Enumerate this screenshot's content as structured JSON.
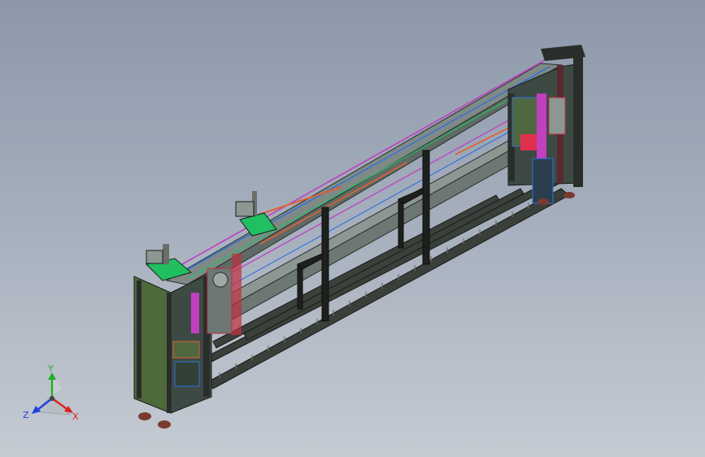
{
  "viewport": {
    "background_top": "#8c98aa",
    "background_bottom": "#c5cbd3"
  },
  "model": {
    "frame_color": "#2a2e2b",
    "rail_color": "#7f8a86",
    "accent_colors": [
      "#c040c0",
      "#3070e0",
      "#20c060",
      "#e06030",
      "#c03040",
      "#506840"
    ]
  },
  "triad": {
    "x_label": "X",
    "y_label": "Y",
    "z_label": "Z",
    "x_color": "#e02020",
    "y_color": "#20b020",
    "z_color": "#2040e0"
  }
}
